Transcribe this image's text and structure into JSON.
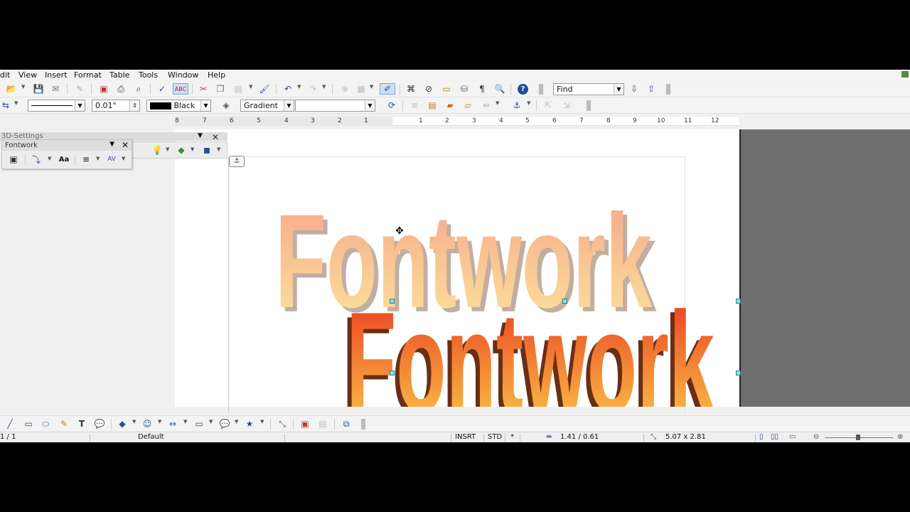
{
  "menu": [
    "dit",
    "View",
    "Insert",
    "Format",
    "Table",
    "Tools",
    "Window",
    "Help"
  ],
  "toolbar": {
    "find_placeholder": "Find",
    "line_width": "0.01\"",
    "line_color": "Black",
    "area_style": "Gradient",
    "area_fill": ""
  },
  "ruler": {
    "left_marks": [
      "8",
      "7",
      "6",
      "5",
      "4",
      "3",
      "2",
      "1"
    ],
    "right_marks": [
      "1",
      "2",
      "3",
      "4",
      "5",
      "6",
      "7",
      "8",
      "9",
      "10",
      "11",
      "12"
    ]
  },
  "panels": {
    "settings_title": "3D-Settings",
    "fontwork_title": "Fontwork",
    "fontwork_btn_same_height": "Aa"
  },
  "document": {
    "fontwork_text_top": "Fontwork",
    "fontwork_text_bottom": "Fontwork",
    "anchor_icon": "anchor-icon"
  },
  "status": {
    "page": "1 / 1",
    "style": "Default",
    "insert_mode": "INSRT",
    "selection_mode": "STD",
    "selection_marker": "*",
    "position": "1.41 / 0.61",
    "size": "5.07 x 2.81"
  },
  "colors": {
    "gradient_top_start": "#f7a48a",
    "gradient_top_end": "#fbe79c",
    "gradient_bottom_start": "#e9301c",
    "gradient_bottom_end": "#fcd24c",
    "extrusion": "#7a5a40"
  }
}
